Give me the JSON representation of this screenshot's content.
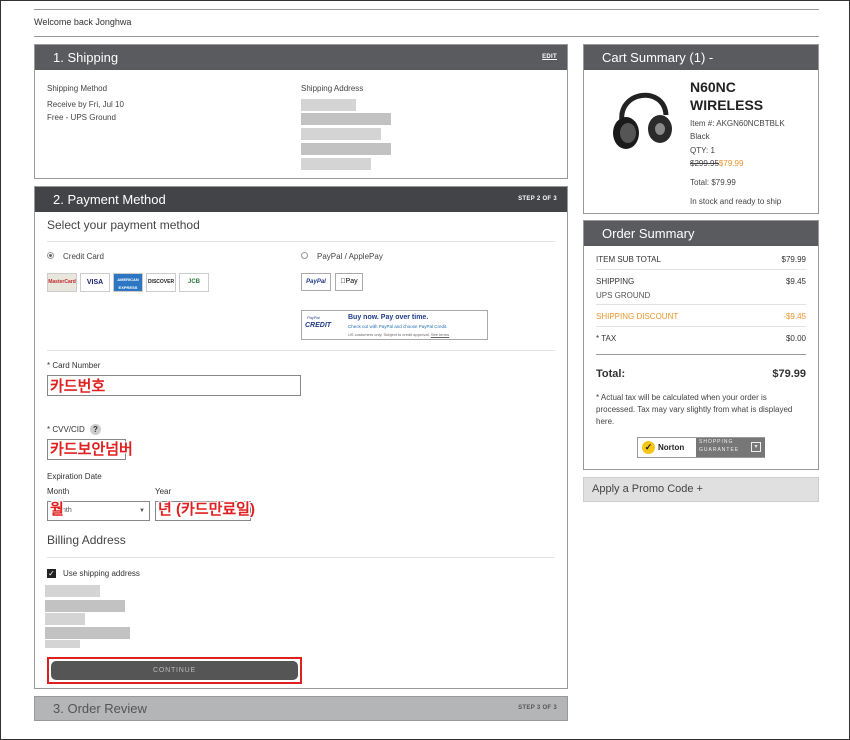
{
  "header": {
    "welcome": "Welcome back Jonghwa"
  },
  "shipping": {
    "title": "1. Shipping",
    "edit": "EDIT",
    "method_label": "Shipping Method",
    "method_line1": "Receive by Fri, Jul 10",
    "method_line2": "Free - UPS Ground",
    "address_label": "Shipping Address"
  },
  "payment": {
    "title": "2. Payment Method",
    "step": "STEP 2 OF 3",
    "select_title": "Select your payment method",
    "credit_card_label": "Credit Card",
    "paypal_label": "PayPal / ApplePay",
    "cards": [
      "MasterCard",
      "VISA",
      "AMERICAN EXPRESS",
      "DISCOVER",
      "JCB"
    ],
    "paypal_btn": "PayPal",
    "applepay_btn": "Pay",
    "credit_banner_logo_small": "PayPal",
    "credit_banner_logo": "CREDIT",
    "credit_banner_title": "Buy now. Pay over time.",
    "credit_banner_line1": "Check out with PayPal and choose PayPal Credit.",
    "credit_banner_line2": "US customers only. Subject to credit approval.",
    "credit_banner_link": "See terms",
    "card_number_label": "* Card Number",
    "card_number_annotation": "카드번호",
    "cvv_label": "* CVV/CID",
    "cvv_help": "?",
    "cvv_annotation": "카드보안넘버",
    "expiration_label": "Expiration Date",
    "month_label": "Month",
    "month_placeholder": "nth",
    "month_annotation": "월",
    "year_label": "Year",
    "year_annotation": "년 (카드만료일)",
    "billing_title": "Billing Address",
    "use_shipping_label": "Use shipping address",
    "continue_label": "CONTINUE"
  },
  "review": {
    "title": "3. Order Review",
    "step": "STEP 3 OF 3"
  },
  "cart": {
    "title": "Cart Summary (1) -",
    "product_name_line1": "N60NC",
    "product_name_line2": "WIRELESS",
    "item": "Item #: AKGN60NCBTBLK",
    "color": "Black",
    "qty": "QTY: 1",
    "old_price": "$299.95",
    "new_price": "$79.99",
    "total": "Total: $79.99",
    "stock": "In stock and ready to ship"
  },
  "order_summary": {
    "title": "Order Summary",
    "subtotal_label": "ITEM SUB TOTAL",
    "subtotal_value": "$79.99",
    "shipping_label": "SHIPPING",
    "shipping_value": "$9.45",
    "shipping_method": "UPS GROUND",
    "discount_label": "SHIPPING DISCOUNT",
    "discount_value": "-$9.45",
    "tax_label": "* TAX",
    "tax_value": "$0.00",
    "total_label": "Total:",
    "total_value": "$79.99",
    "tax_note": "* Actual tax will be calculated when your order is processed. Tax may vary slightly from what is displayed here.",
    "norton_label": "Norton",
    "norton_sub1": "SHOPPING",
    "norton_sub2": "GUARANTEE"
  },
  "promo": {
    "label": "Apply a Promo Code +"
  },
  "colors": {
    "accent_orange": "#e8962e",
    "header_dark": "#434447",
    "header_mid": "#5a5b5e",
    "annotation_red": "#e02020"
  }
}
